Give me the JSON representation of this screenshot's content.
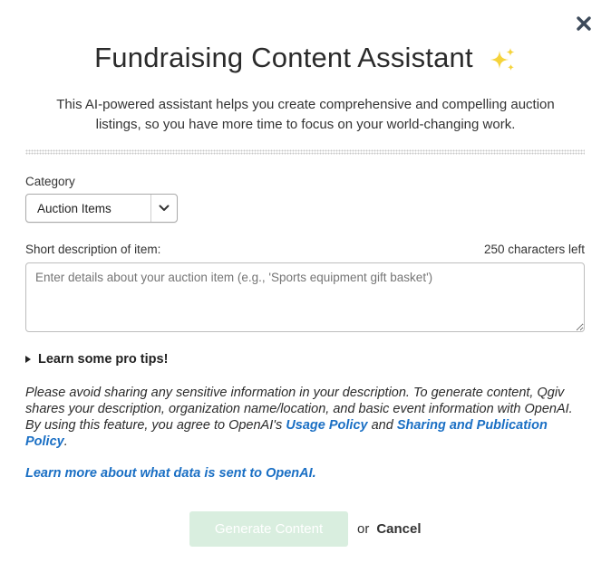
{
  "dialog": {
    "title": "Fundraising Content Assistant",
    "intro": "This AI-powered assistant helps you create comprehensive and compelling auction listings, so you have more time to focus on your world-changing work.",
    "icons": {
      "close": "close-icon",
      "sparkle": "sparkle-icon",
      "caret": "caret-right-icon",
      "select_arrow": "chevron-down-icon"
    },
    "colors": {
      "sparkle": "#f5d33b",
      "link": "#1a6fc4",
      "button_disabled_bg": "#d9eedf"
    }
  },
  "form": {
    "category_label": "Category",
    "category_value": "Auction Items",
    "description_label": "Short description of item:",
    "char_count": "250 characters left",
    "description_placeholder": "Enter details about your auction item (e.g., 'Sports equipment gift basket')"
  },
  "tips": {
    "label": "Learn some pro tips!"
  },
  "disclaimer": {
    "text": "Please avoid sharing any sensitive information in your description. To generate content, Qgiv shares your description, organization name/location, and basic event information with OpenAI. By using this feature, you agree to OpenAI's",
    "usage_policy": "Usage Policy",
    "and": "and",
    "sharing_policy": "Sharing and Publication Policy",
    "end": ".",
    "learn_more": "Learn more about what data is sent to OpenAI."
  },
  "actions": {
    "generate": "Generate Content",
    "or": "or",
    "cancel": "Cancel"
  }
}
